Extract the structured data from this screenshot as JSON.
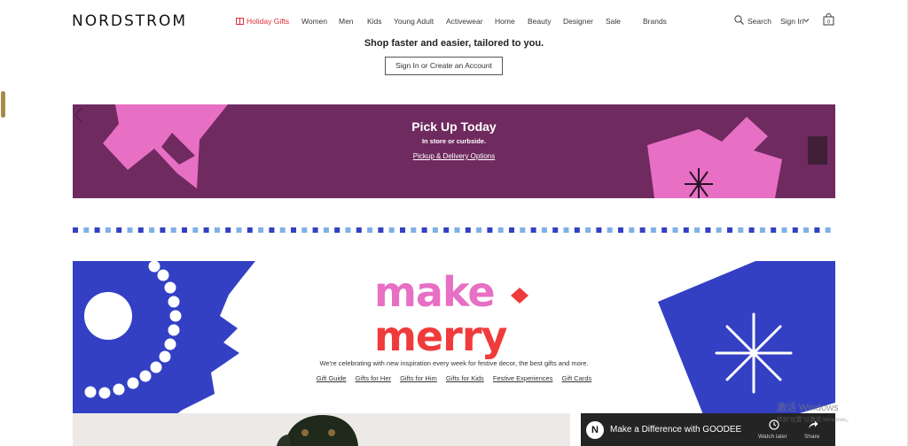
{
  "header": {
    "logo": "NORDSTROM",
    "nav": [
      {
        "label": "Holiday Gifts",
        "highlight": true
      },
      {
        "label": "Women"
      },
      {
        "label": "Men"
      },
      {
        "label": "Kids"
      },
      {
        "label": "Young Adult"
      },
      {
        "label": "Activewear"
      },
      {
        "label": "Home"
      },
      {
        "label": "Beauty"
      },
      {
        "label": "Designer"
      },
      {
        "label": "Sale"
      },
      {
        "label": "Brands"
      }
    ],
    "search_label": "Search",
    "signin_label": "Sign In",
    "bag_count": "0"
  },
  "account": {
    "tagline": "Shop faster and easier, tailored to you.",
    "button_label": "Sign In or Create an Account"
  },
  "promo": {
    "title": "Pick Up Today",
    "subtitle": "In store or curbside.",
    "link": "Pickup & Delivery Options"
  },
  "hero": {
    "headline": "make merry",
    "text": "We're celebrating with new inspiration every week for festive decor, the best gifts and more.",
    "links": [
      "Gift Guide",
      "Gifts for Her",
      "Gifts for Him",
      "Gifts for Kids",
      "Festive Experiences",
      "Gift Cards"
    ]
  },
  "video": {
    "channel_initial": "N",
    "title": "Make a Difference with GOODEE",
    "watch_later": "Watch later",
    "share": "Share"
  },
  "watermark": {
    "line1": "激活 Windows",
    "line2": "转到\"设置\"以激活 Windows。"
  },
  "colors": {
    "accent_red": "#d9303a",
    "promo_bg": "#6f2a5f",
    "pink": "#e76fc4",
    "blue": "#3340c4"
  }
}
